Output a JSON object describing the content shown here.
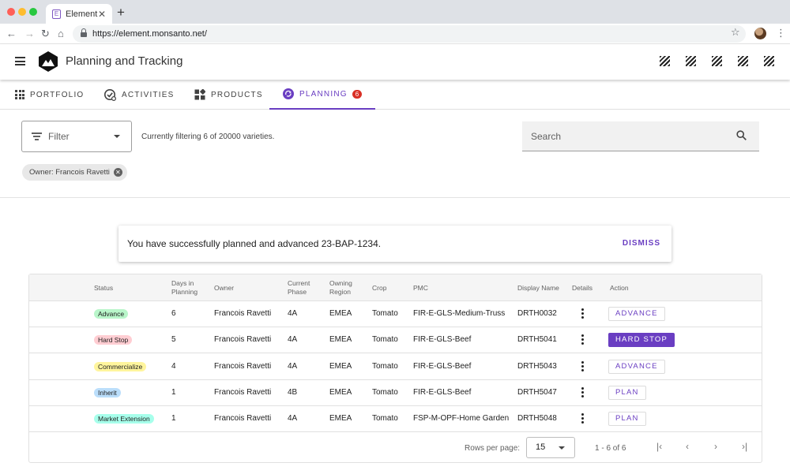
{
  "browser": {
    "tab_title": "Element",
    "favicon_letter": "E",
    "url": "https://element.monsanto.net/",
    "traffic_colors": [
      "#ff5f57",
      "#febc2e",
      "#28c840"
    ]
  },
  "app": {
    "title": "Planning and Tracking",
    "accent": "#6a3ec2"
  },
  "nav": {
    "tabs": [
      {
        "label": "PORTFOLIO",
        "icon": "grid-icon"
      },
      {
        "label": "ACTIVITIES",
        "icon": "check-circle-icon"
      },
      {
        "label": "PRODUCTS",
        "icon": "widgets-icon"
      },
      {
        "label": "PLANNING",
        "icon": "sync-icon",
        "badge": "6",
        "active": true
      }
    ]
  },
  "filter": {
    "label": "Filter",
    "status_text": "Currently filtering 6 of 20000 varieties.",
    "search_placeholder": "Search",
    "chip": "Owner: Francois Ravetti"
  },
  "snackbar": {
    "message": "You have successfully planned and advanced 23-BAP-1234.",
    "dismiss_label": "DISMISS"
  },
  "table": {
    "headers": {
      "status": "Status",
      "days_line1": "Days in",
      "days_line2": "Planning",
      "owner": "Owner",
      "phase_line1": "Current",
      "phase_line2": "Phase",
      "region_line1": "Owning",
      "region_line2": "Region",
      "crop": "Crop",
      "pmc": "PMC",
      "display_name": "Display Name",
      "details": "Details",
      "action": "Action"
    },
    "rows": [
      {
        "status": "Advance",
        "status_color": "#b9f6ca",
        "days": "6",
        "owner": "Francois Ravetti",
        "phase": "4A",
        "region": "EMEA",
        "crop": "Tomato",
        "pmc": "FIR-E-GLS-Medium-Truss",
        "display_name": "DRTH0032",
        "action": "ADVANCE",
        "action_style": "outlined"
      },
      {
        "status": "Hard Stop",
        "status_color": "#ffcdd2",
        "days": "5",
        "owner": "Francois Ravetti",
        "phase": "4A",
        "region": "EMEA",
        "crop": "Tomato",
        "pmc": "FIR-E-GLS-Beef",
        "display_name": "DRTH5041",
        "action": "HARD STOP",
        "action_style": "primary"
      },
      {
        "status": "Commercialize",
        "status_color": "#fff59d",
        "days": "4",
        "owner": "Francois Ravetti",
        "phase": "4A",
        "region": "EMEA",
        "crop": "Tomato",
        "pmc": "FIR-E-GLS-Beef",
        "display_name": "DRTH5043",
        "action": "ADVANCE",
        "action_style": "outlined"
      },
      {
        "status": "Inherit",
        "status_color": "#bbdefb",
        "days": "1",
        "owner": "Francois Ravetti",
        "phase": "4B",
        "region": "EMEA",
        "crop": "Tomato",
        "pmc": "FIR-E-GLS-Beef",
        "display_name": "DRTH5047",
        "action": "PLAN",
        "action_style": "outlined"
      },
      {
        "status": "Market Extension",
        "status_color": "#a7ffeb",
        "days": "1",
        "owner": "Francois Ravetti",
        "phase": "4A",
        "region": "EMEA",
        "crop": "Tomato",
        "pmc": "FSP-M-OPF-Home Garden",
        "display_name": "DRTH5048",
        "action": "PLAN",
        "action_style": "outlined"
      }
    ],
    "footer": {
      "rows_per_page_label": "Rows per page:",
      "rows_per_page_value": "15",
      "range": "1 - 6 of 6"
    }
  }
}
